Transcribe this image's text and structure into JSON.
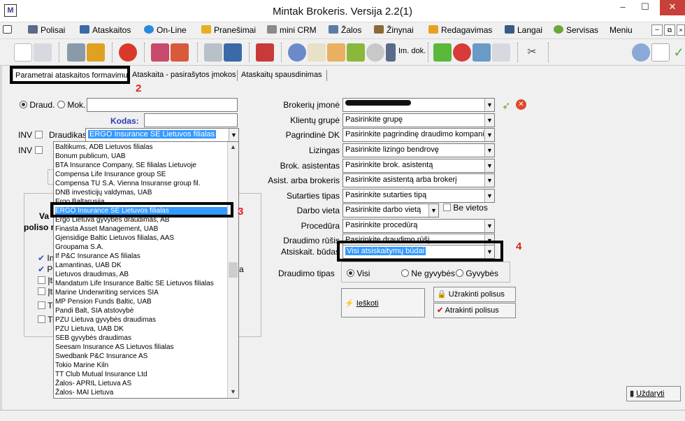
{
  "window": {
    "title": "Mintak Brokeris. Versija 2.2(1)",
    "icon_text": "M",
    "minimize": "–",
    "maximize": "☐",
    "close": "✕"
  },
  "menu": [
    {
      "label": "Polisai",
      "color": "#5a6a8a"
    },
    {
      "label": "Ataskaitos",
      "color": "#3a6aa8"
    },
    {
      "label": "On-Line",
      "color": "#2a8ad8"
    },
    {
      "label": "Pranešimai",
      "color": "#e8b020"
    },
    {
      "label": "mini CRM",
      "color": "#8a8a8a"
    },
    {
      "label": "Žalos",
      "color": "#5a7aa8"
    },
    {
      "label": "Žinynai",
      "color": "#8a6a3a"
    },
    {
      "label": "Redagavimas",
      "color": "#e8a020"
    },
    {
      "label": "Langai",
      "color": "#3a5a8a"
    },
    {
      "label": "Servisas",
      "color": "#6aa83a"
    },
    {
      "label": "Meniu",
      "color": ""
    }
  ],
  "toolbar": {
    "im_dok": "Im. dok."
  },
  "tabs": [
    "Parametrai ataskaitos formavimui",
    "Ataskaita - pasirašytos įmokos",
    "Ataskaitų spausdinimas"
  ],
  "annotations": {
    "n2": "2",
    "n3": "3",
    "n4": "4"
  },
  "left": {
    "draud_label": "Draud.",
    "mok_label": "Mok.",
    "kodas_label": "Kodas:",
    "inv1": "INV",
    "inv2": "INV",
    "draudikas_label": "Draudikas",
    "draudikas_value": "ERGO Insurance SE Lietuvos filialas",
    "partial_va": "Va",
    "partial_poliso": "poliso r",
    "partial_in": "In",
    "partial_pa": "Pa",
    "partial_itr1": "Įtr",
    "partial_itr2": "Įtr",
    "partial_ti1": "Ti",
    "partial_ti2": "Ti",
    "partial_a": "a"
  },
  "dropdown_items": [
    "Baltikums, ADB Lietuvos filialas",
    "Bonum publicum, UAB",
    "BTA Insurance Company, SE filialas Lietuvoje",
    "Compensa Life Insurance group SE",
    "Compensa TU S.A. Vienna Insuranse group fil.",
    "DNB investicijų valdymas, UAB",
    "Ergo Baltarusija",
    "ERGO Insurance SE Lietuvos filialas",
    "Ergo Lietuva gyvybės draudimas, AB",
    "Finasta Asset Management, UAB",
    "Gjensidige Baltic Lietuvos filialas, AAS",
    "Groupama S.A.",
    "If P&C Insurance AS filialas",
    "Lamantinas, UAB DK",
    "Lietuvos draudimas, AB",
    "Mandatum Life Insurance Baltic SE Lietuvos filialas",
    "Marine Underwriting services SIA",
    "MP Pension Funds Baltic, UAB",
    "Pandi Balt, SIA atstovybė",
    "PZU Lietuva gyvybės draudimas",
    "PZU Lietuva, UAB DK",
    "SEB gyvybės draudimas",
    "Seesam Insurance AS Lietuvos filialas",
    "Swedbank P&C Insurance AS",
    "Tokio Marine Kiln",
    "TT Club Mutual Insurance Ltd",
    "Žalos- APRIL Lietuva AS",
    "Žalos- MAI Lietuva"
  ],
  "right": {
    "fields": [
      {
        "label": "Brokerių įmonė",
        "value": ""
      },
      {
        "label": "Klientų grupė",
        "value": "Pasirinkite grupę"
      },
      {
        "label": "Pagrindinė DK",
        "value": "Pasirinkite pagrindinę draudimo kompaniją"
      },
      {
        "label": "Lizingas",
        "value": "Pasirinkite lizingo bendrovę"
      },
      {
        "label": "Brok. asistentas",
        "value": "Pasirinkite brok. asistentą"
      },
      {
        "label": "Asist. arba brokeris",
        "value": "Pasirinkite asistentą arba brokerį"
      },
      {
        "label": "Sutarties tipas",
        "value": "Pasirinkite sutarties tipą"
      },
      {
        "label": "Darbo vieta",
        "value": "Pasirinkite darbo vietą"
      },
      {
        "label": "Procedūra",
        "value": "Pasirinkite procedūrą"
      },
      {
        "label": "Draudimo rūšis",
        "value": "Pasirinkite draudimo rūšį"
      },
      {
        "label": "Atsiskait. būdas",
        "value": "Visi atsiskaitymų būdai"
      }
    ],
    "be_vietos": "Be vietos",
    "draudimo_tipas_label": "Draudimo tipas",
    "tipas_options": [
      "Visi",
      "Ne gyvybės",
      "Gyvybės"
    ],
    "ieskoti": "Ieškoti",
    "uzrakinti": "Užrakinti polisus",
    "atrakinti": "Atrakinti polisus",
    "uzdaryti": "Uždaryti"
  }
}
